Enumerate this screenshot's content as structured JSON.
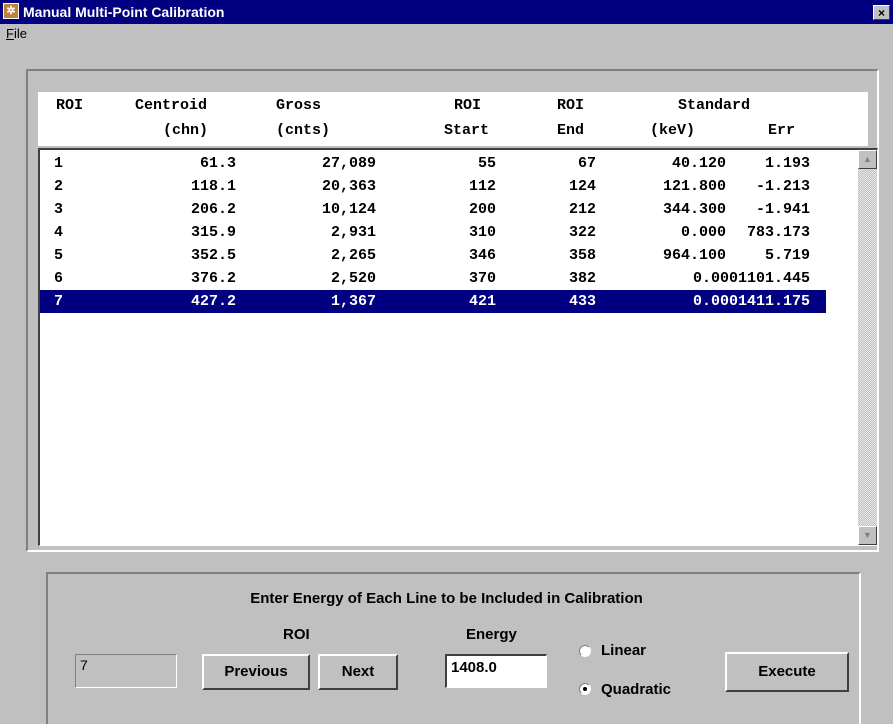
{
  "window": {
    "title": "Manual Multi-Point Calibration",
    "close_label": "×"
  },
  "menu": {
    "file_underlined": "F",
    "file_rest": "ile"
  },
  "table": {
    "headers_row1": [
      "ROI",
      "Centroid",
      "Gross",
      "ROI",
      "ROI",
      "Standard"
    ],
    "headers_row2": [
      "(chn)",
      "(cnts)",
      "Start",
      "End",
      "(keV)",
      "Err"
    ],
    "rows": [
      {
        "roi": "1",
        "centroid": "61.3",
        "gross": "27,089",
        "start": "55",
        "end": "67",
        "standard": "40.120",
        "err": "1.193"
      },
      {
        "roi": "2",
        "centroid": "118.1",
        "gross": "20,363",
        "start": "112",
        "end": "124",
        "standard": "121.800",
        "err": "-1.213"
      },
      {
        "roi": "3",
        "centroid": "206.2",
        "gross": "10,124",
        "start": "200",
        "end": "212",
        "standard": "344.300",
        "err": "-1.941"
      },
      {
        "roi": "4",
        "centroid": "315.9",
        "gross": "2,931",
        "start": "310",
        "end": "322",
        "standard": "0.000",
        "err": "783.173"
      },
      {
        "roi": "5",
        "centroid": "352.5",
        "gross": "2,265",
        "start": "346",
        "end": "358",
        "standard": "964.100",
        "err": "5.719"
      },
      {
        "roi": "6",
        "centroid": "376.2",
        "gross": "2,520",
        "start": "370",
        "end": "382",
        "standard": "0.0001101.445",
        "err": ""
      },
      {
        "roi": "7",
        "centroid": "427.2",
        "gross": "1,367",
        "start": "421",
        "end": "433",
        "standard": "0.0001411.175",
        "err": ""
      }
    ],
    "selected_index": 6
  },
  "controls": {
    "instruction": "Enter Energy of Each Line to be Included in Calibration",
    "roi_label": "ROI",
    "roi_value": "7",
    "previous_label": "Previous",
    "next_label": "Next",
    "energy_label": "Energy",
    "energy_value": "1408.0",
    "linear_label": "Linear",
    "quadratic_label": "Quadratic",
    "selected_fit": "Quadratic",
    "execute_label": "Execute"
  },
  "colors": {
    "title_bar": "#000080",
    "selection": "#000080",
    "face": "#c0c0c0"
  }
}
